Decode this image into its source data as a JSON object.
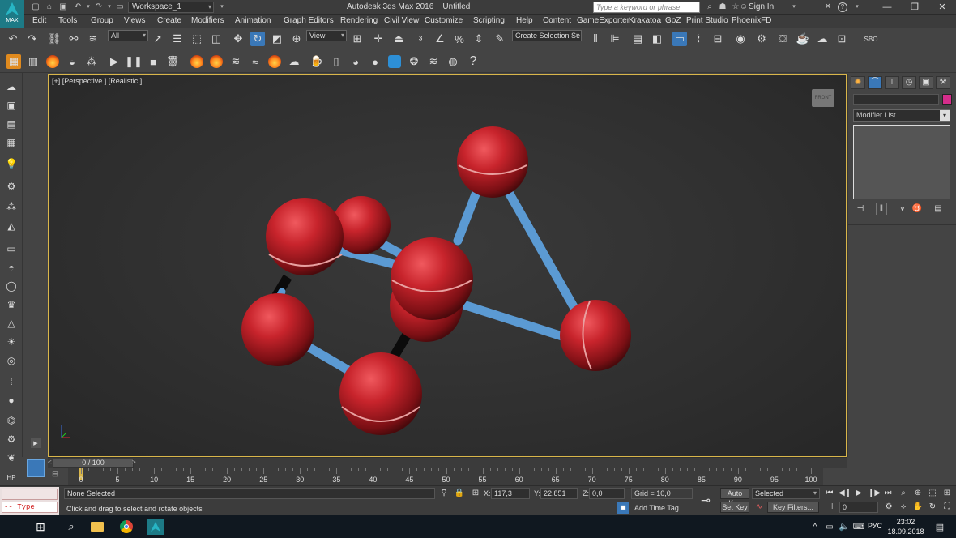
{
  "titlebar": {
    "logo_text": "MAX",
    "workspace": "Workspace_1",
    "app_title": "Autodesk 3ds Max 2016",
    "doc_title": "Untitled",
    "search_placeholder": "Type a keyword or phrase",
    "sign_in": "Sign In"
  },
  "menu": [
    "Edit",
    "Tools",
    "Group",
    "Views",
    "Create",
    "Modifiers",
    "Animation",
    "Graph Editors",
    "Rendering",
    "Civil View",
    "Customize",
    "Scripting",
    "Help",
    "Content",
    "GameExporter",
    "Krakatoa",
    "GoZ",
    "Print Studio",
    "PhoenixFD"
  ],
  "toolbar": {
    "selection_filter": "All",
    "ref_coord": "View",
    "create_selection_set": "Create Selection Se",
    "sbo_label": "SBO"
  },
  "viewport": {
    "label": "[+] [Perspective ] [Realistic ]",
    "viewcube_label": "FRONT"
  },
  "command_panel": {
    "modifier_list": "Modifier List",
    "object_color": "#d52d8b"
  },
  "timeline": {
    "slider_label": "0 / 100",
    "ticks": [
      "0",
      "5",
      "10",
      "15",
      "20",
      "25",
      "30",
      "35",
      "40",
      "45",
      "50",
      "55",
      "60",
      "65",
      "70",
      "75",
      "80",
      "85",
      "90",
      "95",
      "100"
    ]
  },
  "status": {
    "maxscript_error": "-- Type erro:",
    "selection": "None Selected",
    "prompt": "Click and drag to select and rotate objects",
    "x_label": "X:",
    "x_value": "117,3",
    "y_label": "Y:",
    "y_value": "22,851",
    "z_label": "Z:",
    "z_value": "0,0",
    "grid": "Grid = 10,0",
    "add_time_tag": "Add Time Tag",
    "auto_key": "Auto Key",
    "key_mode": "Selected",
    "set_key": "Set Key",
    "key_filters": "Key Filters...",
    "frame": "0"
  },
  "taskbar": {
    "lang": "РУС",
    "time": "23:02",
    "date": "18.09.2018"
  },
  "colors": {
    "viewport_border": "#d9b64a",
    "sphere": "#c8242c",
    "bond": "#5b9ad3",
    "active_tool": "#3a78b8"
  }
}
